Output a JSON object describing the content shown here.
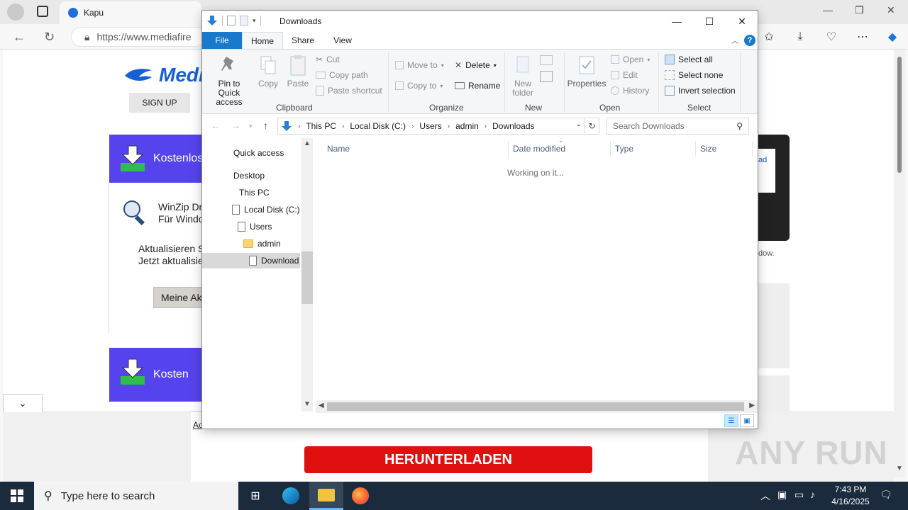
{
  "browser": {
    "tab_title": "Kapu",
    "address": "https://www.mediafire",
    "icons": [
      "back-icon",
      "refresh-icon",
      "lock-icon",
      "collections-icon",
      "downloads-icon",
      "browser-essentials-icon",
      "more-icon",
      "copilot-icon"
    ]
  },
  "page": {
    "logo_text": "Medi",
    "signup": "SIGN UP",
    "ad1_text": "Kostenlos",
    "ad2_text": "Kosten",
    "winzip_line1": "WinZip Dr",
    "winzip_line2": "Für Windo",
    "update_line1": "Aktualisieren S",
    "update_line2": "Jetzt aktualisie",
    "meine_button": "Meine Ak",
    "right_ad_link": "ad",
    "right_dow": "dow.",
    "bottom_ad_text": "Ac",
    "download_button": "HERUNTERLADEN",
    "watermark": "ANY RUN"
  },
  "explorer": {
    "title": "Downloads",
    "tabs": {
      "file": "File",
      "home": "Home",
      "share": "Share",
      "view": "View"
    },
    "ribbon": {
      "clipboard": {
        "label": "Clipboard",
        "pin": "Pin to Quick access",
        "copy": "Copy",
        "paste": "Paste",
        "cut": "Cut",
        "copy_path": "Copy path",
        "paste_shortcut": "Paste shortcut"
      },
      "organize": {
        "label": "Organize",
        "move_to": "Move to",
        "copy_to": "Copy to",
        "delete": "Delete",
        "rename": "Rename"
      },
      "new": {
        "label": "New",
        "new_folder": "New folder"
      },
      "open": {
        "label": "Open",
        "properties": "Properties",
        "open": "Open",
        "edit": "Edit",
        "history": "History"
      },
      "select": {
        "label": "Select",
        "select_all": "Select all",
        "select_none": "Select none",
        "invert": "Invert selection"
      }
    },
    "breadcrumb": [
      "This PC",
      "Local Disk (C:)",
      "Users",
      "admin",
      "Downloads"
    ],
    "search_placeholder": "Search Downloads",
    "nav": {
      "quick_access": "Quick access",
      "desktop": "Desktop",
      "this_pc": "This PC",
      "local_disk": "Local Disk (C:)",
      "users": "Users",
      "admin": "admin",
      "downloads": "Download"
    },
    "columns": {
      "name": "Name",
      "date": "Date modified",
      "type": "Type",
      "size": "Size"
    },
    "status_message": "Working on it..."
  },
  "taskbar": {
    "search_placeholder": "Type here to search",
    "time": "7:43 PM",
    "date": "4/16/2025"
  }
}
